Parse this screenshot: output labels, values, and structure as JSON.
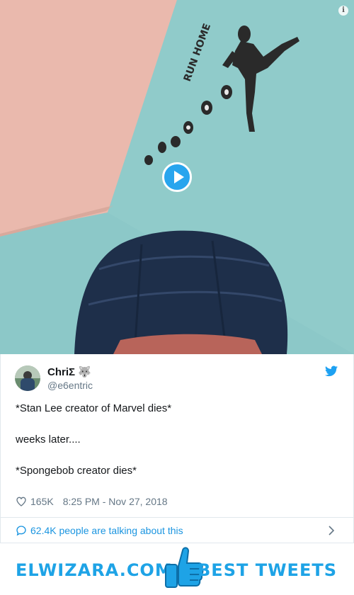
{
  "media": {
    "wall_text": "RUN HOME",
    "info_label": "i"
  },
  "tweet": {
    "display_name": "ChriΣ",
    "display_emoji": "🐺",
    "handle": "@e6entric",
    "lines": [
      "*Stan Lee creator of Marvel dies*",
      "weeks later....",
      "*Spongebob creator dies*"
    ],
    "likes": "165K",
    "timestamp": "8:25 PM - Nov 27, 2018",
    "talking": "62.4K people are talking about this"
  },
  "banner": {
    "left_text": "ELWIZARA.COM",
    "right_text": "BEST TWEETS"
  },
  "colors": {
    "accent": "#1da1f2",
    "link": "#1b95e0",
    "muted": "#657786",
    "brand": "#1ea3e6"
  },
  "icons": [
    "info-icon",
    "play-icon",
    "twitter-icon",
    "heart-icon",
    "comment-icon",
    "chevron-right-icon",
    "thumbs-up-icon"
  ]
}
